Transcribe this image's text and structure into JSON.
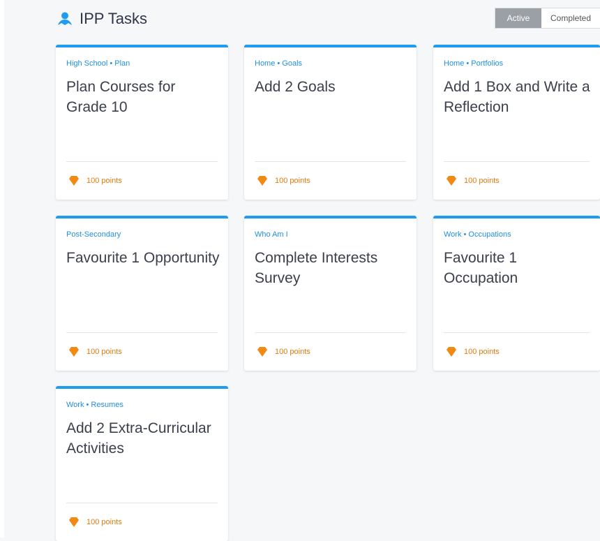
{
  "header": {
    "title": "IPP Tasks",
    "icon": "user-group-icon"
  },
  "filter": {
    "active_label": "Active",
    "completed_label": "Completed"
  },
  "colors": {
    "accent": "#1f9bf0",
    "points": "#e07a0c",
    "toggle_active": "#9b9fa6"
  },
  "cards": [
    {
      "category": "High School • Plan",
      "title": "Plan Courses for Grade 10",
      "points": "100 points"
    },
    {
      "category": "Home • Goals",
      "title": "Add 2 Goals",
      "points": "100 points"
    },
    {
      "category": "Home • Portfolios",
      "title": "Add 1 Box and Write a Reflection",
      "points": "100 points"
    },
    {
      "category": "Post-Secondary",
      "title": "Favourite 1 Opportunity",
      "points": "100 points"
    },
    {
      "category": "Who Am I",
      "title": "Complete Interests Survey",
      "points": "100 points"
    },
    {
      "category": "Work • Occupations",
      "title": "Favourite 1 Occupation",
      "points": "100 points"
    },
    {
      "category": "Work • Resumes",
      "title": "Add 2 Extra-Curricular Activities",
      "points": "100 points"
    }
  ]
}
